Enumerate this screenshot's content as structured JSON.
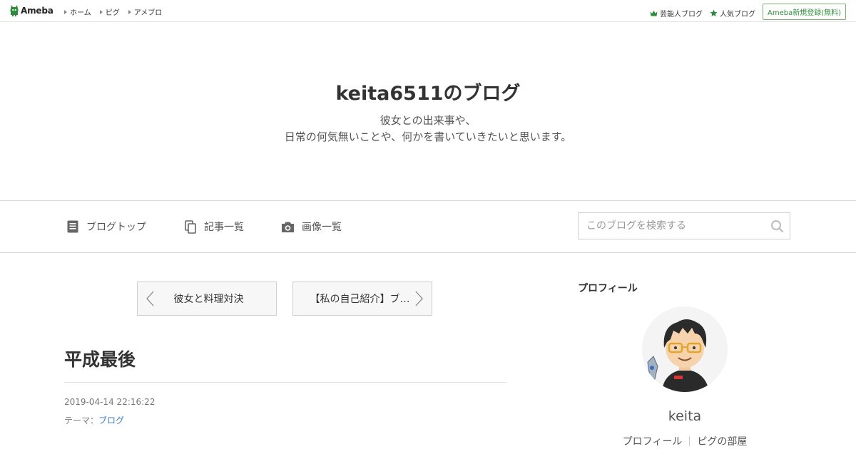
{
  "topbar": {
    "logo_text": "Ameba",
    "nav": [
      "ホーム",
      "ピグ",
      "アメブロ"
    ],
    "celebrity_blog": "芸能人ブログ",
    "popular_blog": "人気ブログ",
    "signup": "Ameba新規登録(無料)",
    "accent_color": "#2d8c3c"
  },
  "header": {
    "title": "keita6511のブログ",
    "description_line1": "彼女との出来事や、",
    "description_line2": "日常の何気無いことや、何かを書いていきたいと思います。"
  },
  "nav": {
    "blog_top": "ブログトップ",
    "article_list": "記事一覧",
    "image_list": "画像一覧",
    "search_placeholder": "このブログを検索する"
  },
  "pager": {
    "prev": "彼女と料理対決",
    "next": "【私の自己紹介】ブ…"
  },
  "article": {
    "title": "平成最後",
    "date": "2019-04-14 22:16:22",
    "theme_label": "テーマ：",
    "theme": "ブログ"
  },
  "sidebar": {
    "heading": "プロフィール",
    "name": "keita",
    "profile_link": "プロフィール",
    "pigg_link": "ピグの部屋"
  }
}
